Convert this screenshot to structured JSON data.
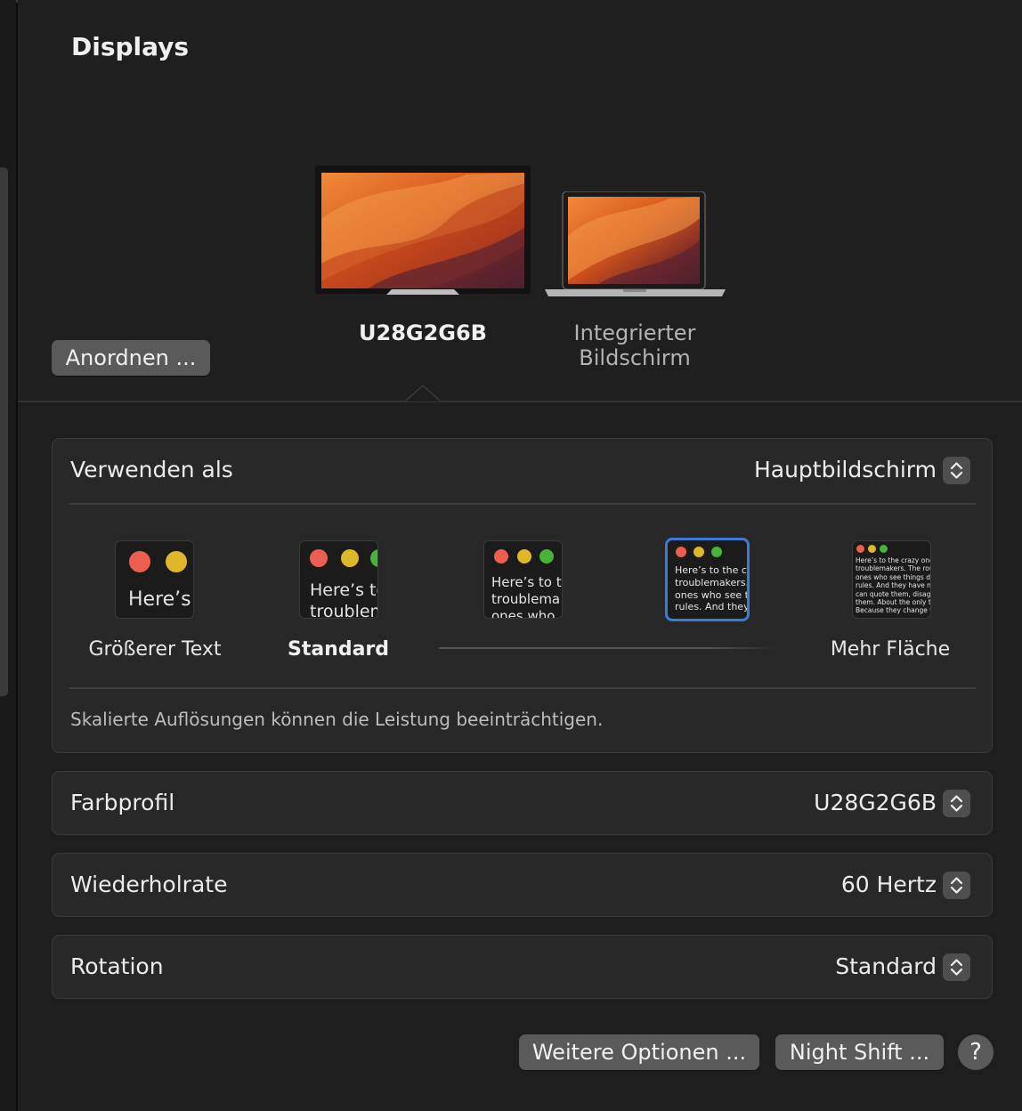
{
  "window": {
    "title": "Displays"
  },
  "header": {
    "arrange_button": "Anordnen ...",
    "displays": [
      {
        "label": "U28G2G6B",
        "selected": true
      },
      {
        "label_line1": "Integrierter",
        "label_line2": "Bildschirm",
        "selected": false
      }
    ]
  },
  "use_as": {
    "label": "Verwenden als",
    "value": "Hauptbildschirm"
  },
  "resolution": {
    "options": [
      {
        "label": "Größerer Text",
        "sample": "Here’s"
      },
      {
        "label": "Standard",
        "sample": "Here’s to\ntroublem"
      },
      {
        "label": "",
        "sample": "Here’s to t\ntroublema\nones who"
      },
      {
        "label": "",
        "sample": "Here’s to the cr\ntroublemakers.\nones who see t\nrules. And they",
        "selected": true
      },
      {
        "label": "Mehr Fläche",
        "sample": "Here’s to the crazy one\ntroublemakers. The rou\nones who see things dif\nrules. And they have no\ncan quote them, disagr\nthem. About the only th\nBecause they change th"
      }
    ],
    "note": "Skalierte Auflösungen können die Leistung beeinträchtigen."
  },
  "color_profile": {
    "label": "Farbprofil",
    "value": "U28G2G6B"
  },
  "refresh_rate": {
    "label": "Wiederholrate",
    "value": "60 Hertz"
  },
  "rotation": {
    "label": "Rotation",
    "value": "Standard"
  },
  "footer": {
    "more_options_button": "Weitere Optionen ...",
    "night_shift_button": "Night Shift ...",
    "help_button": "?"
  },
  "colors": {
    "window_bg": "#1e1e1e",
    "card_bg": "#282828",
    "button_bg": "#5a5a5a",
    "selection_accent": "#3a7bd5",
    "traffic_red": "#ec5f50",
    "traffic_yellow": "#dfb82a",
    "traffic_green": "#46b437"
  }
}
